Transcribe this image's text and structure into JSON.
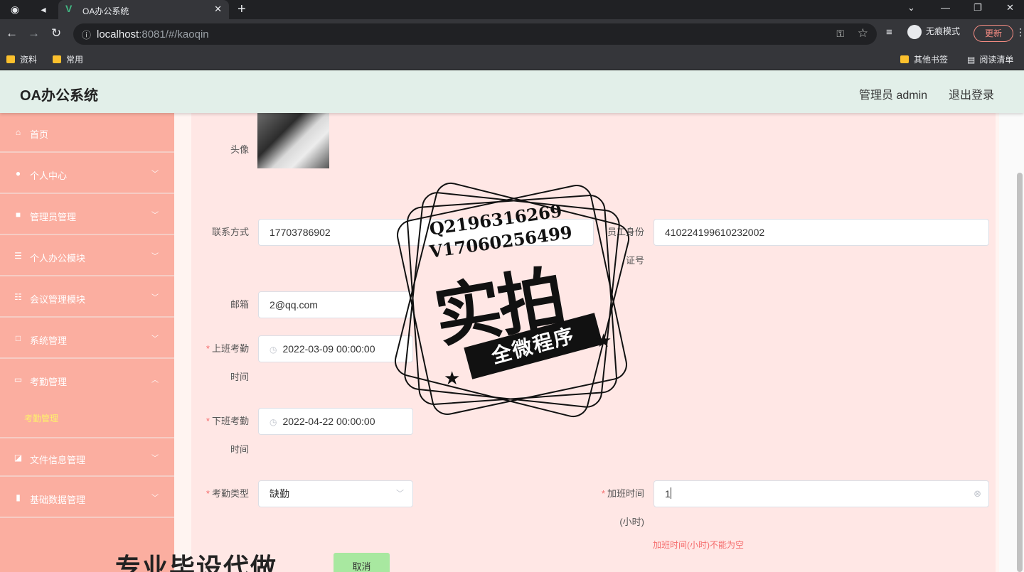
{
  "browser": {
    "tab_title": "OA办公系统",
    "url_host": "localhost",
    "url_rest": ":8081/#/kaoqin",
    "incognito_label": "无痕模式",
    "update_label": "更新",
    "bookmarks": [
      "资料",
      "常用"
    ],
    "bookmarks_right": [
      "其他书签",
      "阅读清单"
    ]
  },
  "header": {
    "title": "OA办公系统",
    "user": "管理员 admin",
    "logout": "退出登录"
  },
  "sidebar": {
    "items": [
      {
        "label": "首页",
        "icon": "home-icon"
      },
      {
        "label": "个人中心",
        "icon": "user-icon"
      },
      {
        "label": "管理员管理",
        "icon": "briefcase-icon"
      },
      {
        "label": "个人办公模块",
        "icon": "stack-icon"
      },
      {
        "label": "会议管理模块",
        "icon": "sliders-icon"
      },
      {
        "label": "系统管理",
        "icon": "crop-icon"
      },
      {
        "label": "考勤管理",
        "icon": "card-icon"
      },
      {
        "label": "文件信息管理",
        "icon": "chart-line-icon"
      },
      {
        "label": "基础数据管理",
        "icon": "bar-chart-icon"
      }
    ],
    "sub_item": "考勤管理"
  },
  "form": {
    "avatar_label": "头像",
    "phone_label": "联系方式",
    "phone_value": "17703786902",
    "id_label_1": "员工身份",
    "id_label_2": "证号",
    "id_value": "410224199610232002",
    "email_label": "邮箱",
    "email_value": "2@qq.com",
    "checkin_label_1": "上班考勤",
    "checkin_label_2": "时间",
    "checkin_value": "2022-03-09 00:00:00",
    "checkout_label_1": "下班考勤",
    "checkout_label_2": "时间",
    "checkout_value": "2022-04-22 00:00:00",
    "type_label": "考勤类型",
    "type_value": "缺勤",
    "overtime_label_1": "加班时间",
    "overtime_label_2": "(小时)",
    "overtime_value": "1",
    "overtime_error": "加班时间(小时)不能为空",
    "required_mark": "*",
    "cancel_label": "取消"
  },
  "watermark": {
    "contact_q": "Q2196316269",
    "contact_v": "V17060256499",
    "big_text": "实拍",
    "ribbon_text": "全微程序",
    "bottom_text": "专业毕设代做"
  }
}
